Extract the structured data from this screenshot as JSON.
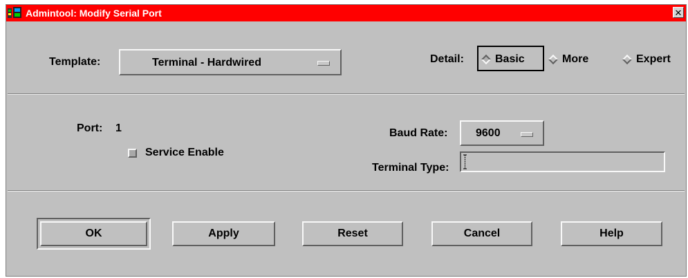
{
  "window": {
    "title": "Admintool: Modify Serial Port",
    "close_glyph": "✕"
  },
  "template": {
    "label": "Template:",
    "value": "Terminal - Hardwired"
  },
  "detail": {
    "label": "Detail:",
    "options": [
      "Basic",
      "More",
      "Expert"
    ],
    "selected": "Basic"
  },
  "port": {
    "label": "Port:",
    "value": "1"
  },
  "service_enable": {
    "label": "Service Enable",
    "checked": false
  },
  "baud_rate": {
    "label": "Baud Rate:",
    "value": "9600"
  },
  "terminal_type": {
    "label": "Terminal Type:",
    "value": ""
  },
  "buttons": {
    "ok": "OK",
    "apply": "Apply",
    "reset": "Reset",
    "cancel": "Cancel",
    "help": "Help"
  },
  "icons": {
    "app": "admintool-app-icon",
    "close": "close-icon",
    "option_menu": "option-menu-indicator-icon",
    "radio": "diamond-radio-icon",
    "text_cursor": "text-cursor-icon"
  },
  "colors": {
    "titlebar": "#ff0000",
    "title_text": "#ffffff",
    "window_bg": "#c0c0c0"
  }
}
